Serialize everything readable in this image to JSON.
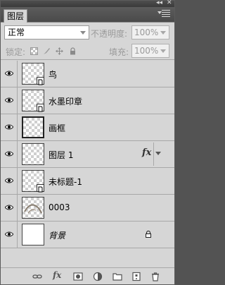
{
  "panel": {
    "tab_label": "图层",
    "collapse_glyph": "◂◂",
    "close_glyph": "✕"
  },
  "blend": {
    "mode": "正常",
    "opacity_label": "不透明度:",
    "opacity_value": "100%"
  },
  "lock": {
    "lock_label": "锁定:",
    "fill_label": "填充:",
    "fill_value": "100%"
  },
  "layers": [
    {
      "name": "鸟",
      "thumb": "checker",
      "smart": true,
      "italic": false
    },
    {
      "name": "水墨印章",
      "thumb": "checker",
      "smart": true,
      "italic": false
    },
    {
      "name": "画框",
      "thumb": "checker-selected",
      "smart": false,
      "italic": false
    },
    {
      "name": "图层 1",
      "thumb": "checker",
      "smart": false,
      "italic": false,
      "fx": "fx"
    },
    {
      "name": "未标题-1",
      "thumb": "checker",
      "smart": true,
      "italic": false
    },
    {
      "name": "0003",
      "thumb": "checker-art",
      "smart": false,
      "italic": false
    },
    {
      "name": "背景",
      "thumb": "white",
      "smart": false,
      "italic": true,
      "locked": true
    }
  ],
  "bottom_icons": [
    "link-layers-icon",
    "fx-icon",
    "add-mask-icon",
    "adjustment-layer-icon",
    "new-group-icon",
    "new-layer-icon",
    "delete-layer-icon"
  ],
  "bottom_fx_label": "fx"
}
